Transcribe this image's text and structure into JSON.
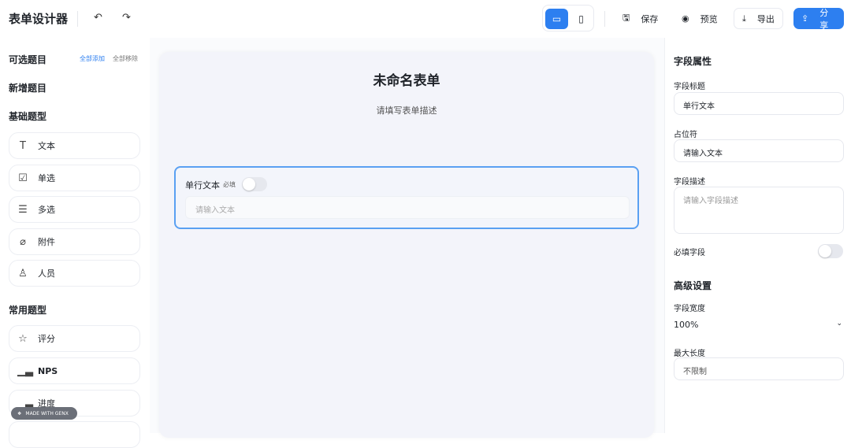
{
  "header": {
    "title": "表单设计器",
    "save": "保存",
    "preview": "预览",
    "export": "导出",
    "share": "分享"
  },
  "colors": {
    "accent": "#2d7ff0"
  },
  "left": {
    "optional_title": "可选题目",
    "add_all": "全部添加",
    "remove_all": "全部移除",
    "new_title": "新增题目",
    "basic_title": "基础题型",
    "basic_items": [
      {
        "label": "文本",
        "icon": "text-icon"
      },
      {
        "label": "单选",
        "icon": "checkbox-icon"
      },
      {
        "label": "多选",
        "icon": "list-icon"
      },
      {
        "label": "附件",
        "icon": "paperclip-icon"
      },
      {
        "label": "人员",
        "icon": "user-icon"
      }
    ],
    "common_title": "常用题型",
    "common_items": [
      {
        "label": "评分",
        "icon": "star-icon"
      },
      {
        "label": "NPS",
        "icon": "bar-chart-icon"
      },
      {
        "label": "进度",
        "icon": "bar-chart-icon"
      }
    ]
  },
  "badge": "MADE WITH GENX",
  "canvas": {
    "title": "未命名表单",
    "description": "请填写表单描述",
    "field": {
      "label": "单行文本",
      "required": "必填",
      "placeholder": "请输入文本"
    }
  },
  "right": {
    "title": "字段属性",
    "field_title_label": "字段标题",
    "field_title_value": "单行文本",
    "placeholder_label": "占位符",
    "placeholder_value": "请输入文本",
    "desc_label": "字段描述",
    "desc_placeholder": "请输入字段描述",
    "required_label": "必填字段",
    "advanced_title": "高级设置",
    "width_label": "字段宽度",
    "width_value": "100%",
    "maxlen_label": "最大长度",
    "maxlen_placeholder": "不限制"
  }
}
